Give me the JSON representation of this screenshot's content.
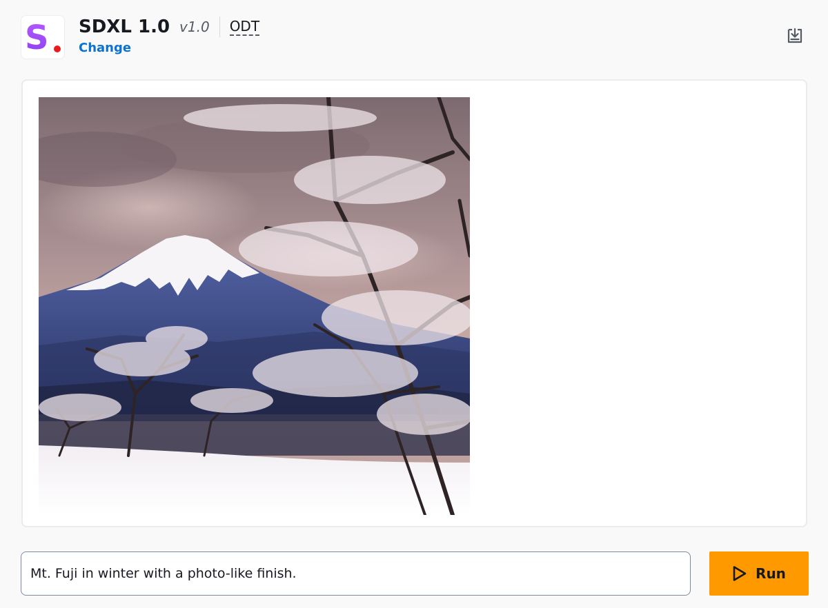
{
  "header": {
    "logo": {
      "letter": "S",
      "icon": "model-logo-icon",
      "gradient": [
        "#b65cff",
        "#8b3df2"
      ],
      "dot_color": "#e81c1c"
    },
    "model_name": "SDXL 1.0",
    "model_version": "v1.0",
    "badge": "ODT",
    "change_link": "Change",
    "download_icon": "download-icon"
  },
  "canvas": {
    "image": {
      "subject": "Mt. Fuji in winter with snow-covered trees",
      "sky_colors": [
        "#7c6a70",
        "#a88f91",
        "#c9aaa6"
      ],
      "mountain_color": "#3e4c88",
      "snow_color": "#f6f4f6"
    }
  },
  "prompt": {
    "value": "Mt. Fuji in winter with a photo-like finish.",
    "placeholder": ""
  },
  "run_button": {
    "label": "Run",
    "icon": "play-icon",
    "color": "#ff9900"
  }
}
